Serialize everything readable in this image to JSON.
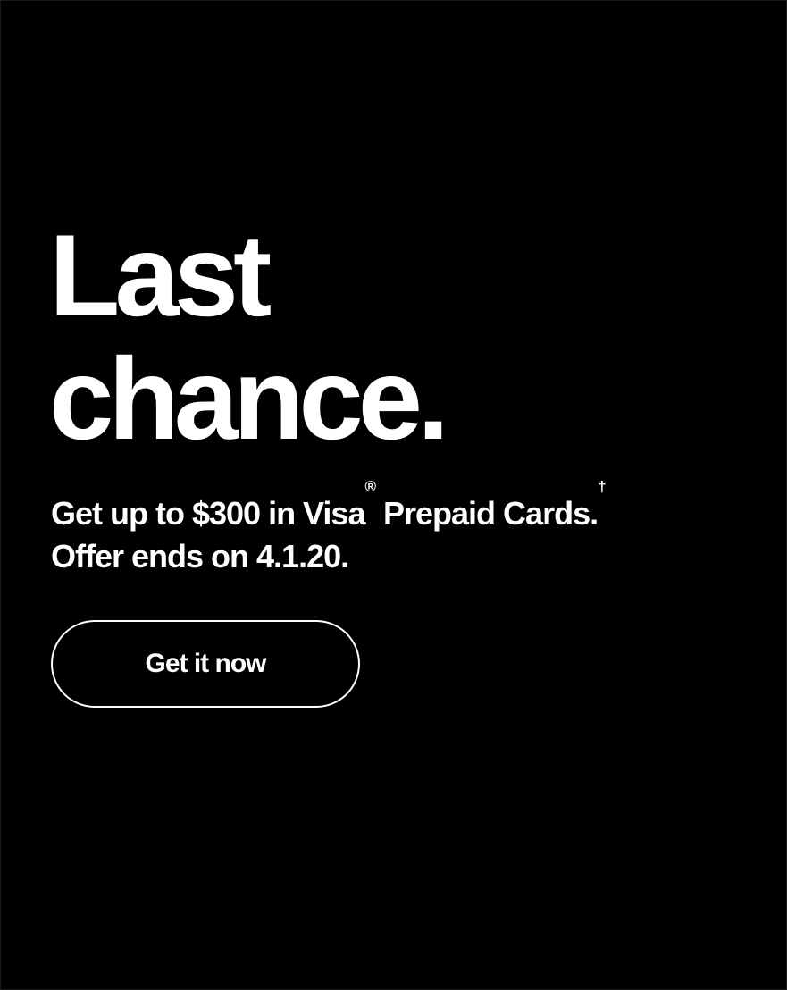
{
  "promo": {
    "headline_line1": "Last",
    "headline_line2": "chance.",
    "offer_part1": "Get up to $300 in Visa",
    "offer_registered_mark": "®",
    "offer_part2": " Prepaid Cards.",
    "offer_dagger_mark": "†",
    "offer_end_text": "Offer ends on 4.1.20.",
    "cta_label": "Get it now"
  },
  "colors": {
    "background": "#000000",
    "text": "#ffffff",
    "button_border": "#ffffff"
  }
}
